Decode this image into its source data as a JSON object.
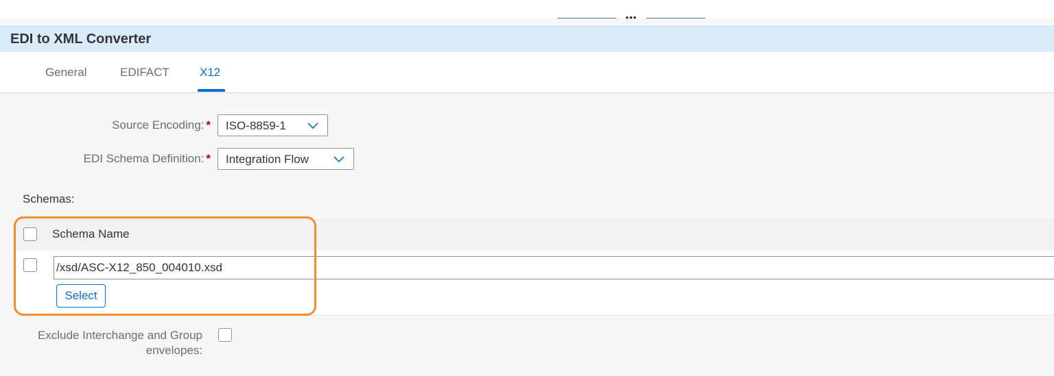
{
  "app": {
    "title": "EDI to XML Converter"
  },
  "tabs": [
    {
      "label": "General",
      "selected": false
    },
    {
      "label": "EDIFACT",
      "selected": false
    },
    {
      "label": "X12",
      "selected": true
    }
  ],
  "form": {
    "source_encoding": {
      "label": "Source Encoding:",
      "required_mark": "*",
      "value": "ISO-8859-1"
    },
    "schema_definition": {
      "label": "EDI Schema Definition:",
      "required_mark": "*",
      "value": "Integration Flow"
    }
  },
  "schemas": {
    "label": "Schemas:",
    "header": {
      "column": "Schema Name"
    },
    "rows": [
      {
        "value": "/xsd/ASC-X12_850_004010.xsd",
        "checked": false
      }
    ],
    "select_button": "Select"
  },
  "exclude_envelopes": {
    "label_line1": "Exclude Interchange and Group",
    "label_line2": "envelopes:",
    "checked": false
  },
  "icons": {
    "dropdown": "chevron-down-icon",
    "splitter": "splitter-handle-icon"
  },
  "colors": {
    "accent": "#0a6ed1",
    "title_bar": "#dcebfa",
    "required": "#bb0000",
    "highlight": "#f58b2b"
  }
}
